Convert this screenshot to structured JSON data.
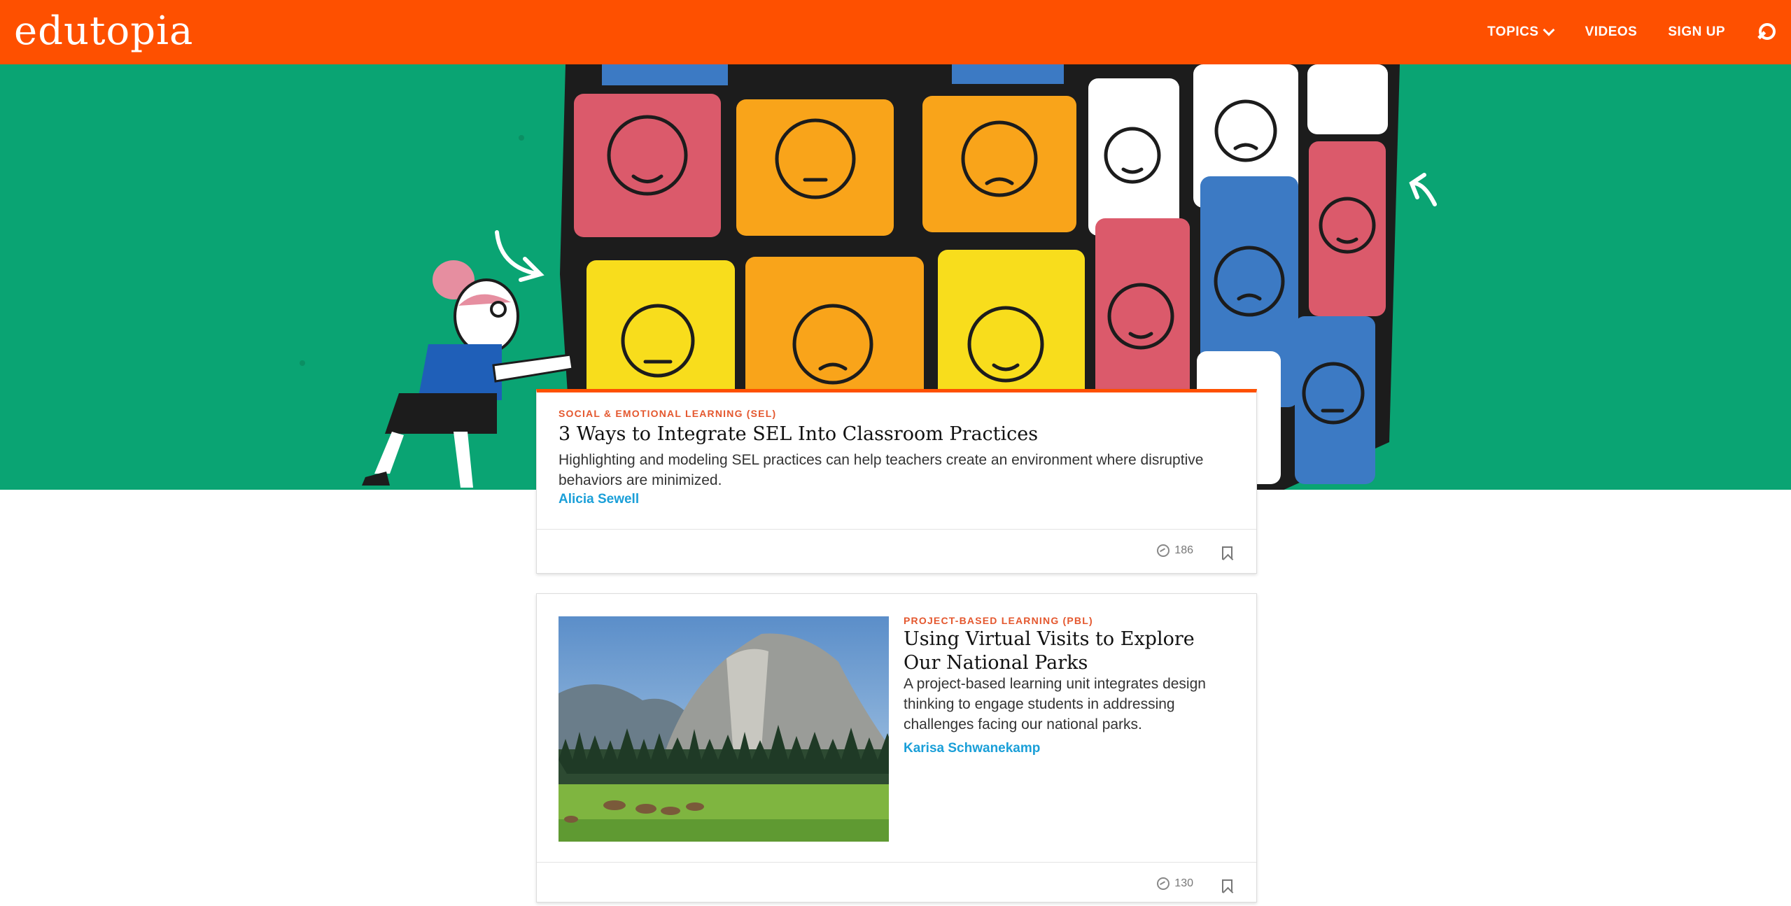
{
  "header": {
    "logo": "edutopia",
    "nav": [
      {
        "label": "TOPICS"
      },
      {
        "label": "VIDEOS"
      },
      {
        "label": "SIGN UP"
      }
    ]
  },
  "featured": {
    "kicker": "SOCIAL & EMOTIONAL LEARNING (SEL)",
    "title": "3 Ways to Integrate SEL Into Classroom Practices",
    "description": "Highlighting and modeling SEL practices can help teachers create an environment where disruptive behaviors are minimized.",
    "author": "Alicia Sewell",
    "count": "186"
  },
  "articles": [
    {
      "kicker": "PROJECT-BASED LEARNING (PBL)",
      "title": "Using Virtual Visits to Explore Our National Parks",
      "description": "A project-based learning unit integrates design thinking to engage students in addressing challenges facing our national parks.",
      "author": "Karisa Schwanekamp",
      "count": "130"
    }
  ],
  "colors": {
    "brand": "#fe5000",
    "hero_bg": "#0aa473",
    "link": "#1a9fd8"
  },
  "icons": [
    "search-icon",
    "chevron-down-icon",
    "shares-icon",
    "bookmark-icon"
  ]
}
